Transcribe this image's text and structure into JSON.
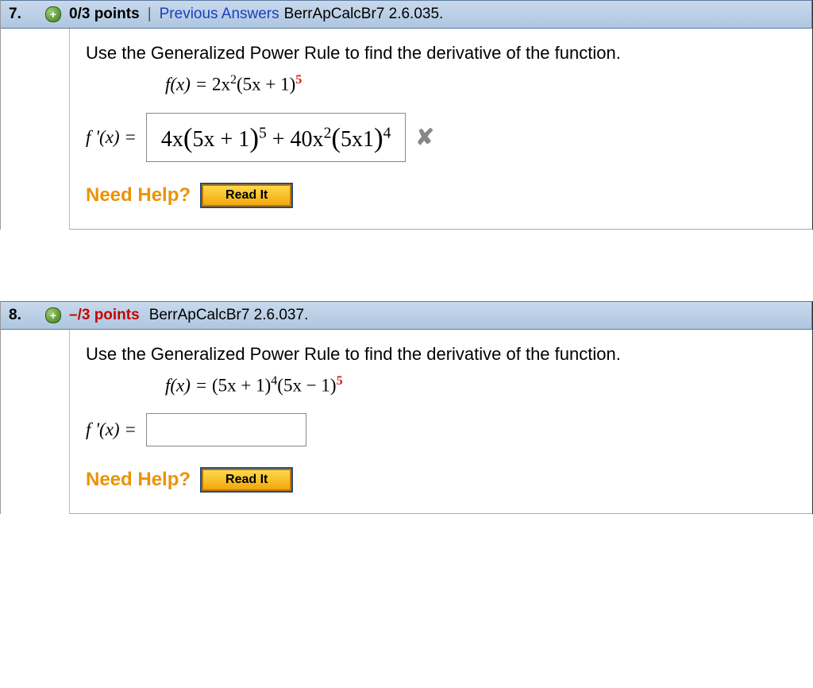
{
  "q7": {
    "number": "7.",
    "points": "0/3 points",
    "prev": "Previous Answers",
    "ref": "BerrApCalcBr7 2.6.035.",
    "prompt": "Use the Generalized Power Rule to find the derivative of the function.",
    "func_lhs": "f(x) = ",
    "func_rhs_a": "2x",
    "func_rhs_b": "(5x + 1)",
    "deriv_lhs": "f '(x) = ",
    "answer_1a": "4x",
    "answer_1b": "5x + 1",
    "answer_mid": " + 40x",
    "answer_2b": "5x1",
    "need_help": "Need Help?",
    "readit": "Read It"
  },
  "q8": {
    "number": "8.",
    "points": "–/3 points",
    "ref": "BerrApCalcBr7 2.6.037.",
    "prompt": "Use the Generalized Power Rule to find the derivative of the function.",
    "func_lhs": "f(x) = ",
    "p1": "(5x + 1)",
    "p2": "(5x − 1)",
    "deriv_lhs": "f '(x) = ",
    "need_help": "Need Help?",
    "readit": "Read It"
  }
}
